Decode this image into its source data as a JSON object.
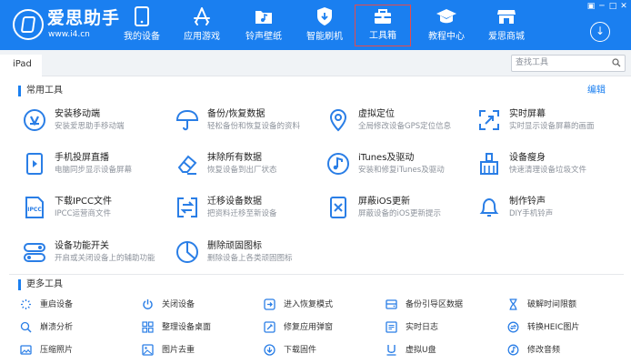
{
  "header": {
    "logo_text": "爱思助手",
    "logo_url": "www.i4.cn",
    "nav": [
      {
        "label": "我的设备",
        "icon": "phone-icon"
      },
      {
        "label": "应用游戏",
        "icon": "app-store-icon"
      },
      {
        "label": "铃声壁纸",
        "icon": "music-folder-icon"
      },
      {
        "label": "智能刷机",
        "icon": "shield-icon"
      },
      {
        "label": "工具箱",
        "icon": "toolbox-icon",
        "active": true
      },
      {
        "label": "教程中心",
        "icon": "graduation-cap-icon"
      },
      {
        "label": "爱思商城",
        "icon": "store-icon"
      }
    ],
    "window_controls": [
      "▣",
      "─",
      "□",
      "✕"
    ],
    "download_icon": "download-icon"
  },
  "tabbar": {
    "device_tab": "iPad",
    "search_placeholder": "查找工具"
  },
  "common_tools": {
    "title": "常用工具",
    "edit": "编辑",
    "items": [
      {
        "name": "安装移动端",
        "desc": "安装爱思助手移动端",
        "icon": "install-mobile-icon"
      },
      {
        "name": "备份/恢复数据",
        "desc": "轻松备份和恢复设备的资料",
        "icon": "umbrella-icon"
      },
      {
        "name": "虚拟定位",
        "desc": "全局修改设备GPS定位信息",
        "icon": "location-pin-icon"
      },
      {
        "name": "实时屏幕",
        "desc": "实时显示设备屏幕的画面",
        "icon": "screen-expand-icon"
      },
      {
        "name": "手机投屏直播",
        "desc": "电脑同步显示设备屏幕",
        "icon": "screen-cast-icon"
      },
      {
        "name": "抹除所有数据",
        "desc": "恢复设备到出厂状态",
        "icon": "eraser-icon"
      },
      {
        "name": "iTunes及驱动",
        "desc": "安装和修复iTunes及驱动",
        "icon": "itunes-icon"
      },
      {
        "name": "设备瘦身",
        "desc": "快速清理设备垃圾文件",
        "icon": "broom-icon"
      },
      {
        "name": "下载IPCC文件",
        "desc": "IPCC运营商文件",
        "icon": "ipcc-file-icon"
      },
      {
        "name": "迁移设备数据",
        "desc": "把资料迁移至新设备",
        "icon": "transfer-icon"
      },
      {
        "name": "屏蔽iOS更新",
        "desc": "屏蔽设备的iOS更新提示",
        "icon": "block-update-icon"
      },
      {
        "name": "制作铃声",
        "desc": "DIY手机铃声",
        "icon": "bell-icon"
      },
      {
        "name": "设备功能开关",
        "desc": "开启或关闭设备上的辅助功能",
        "icon": "toggle-icon"
      },
      {
        "name": "删除顽固图标",
        "desc": "删除设备上各类顽固图标",
        "icon": "pie-delete-icon"
      }
    ]
  },
  "more_tools": {
    "title": "更多工具",
    "items": [
      {
        "label": "重启设备",
        "icon": "restart-icon"
      },
      {
        "label": "关闭设备",
        "icon": "power-icon"
      },
      {
        "label": "进入恢复模式",
        "icon": "recovery-icon"
      },
      {
        "label": "备份引导区数据",
        "icon": "backup-boot-icon"
      },
      {
        "label": "破解时间限额",
        "icon": "hourglass-icon"
      },
      {
        "label": "崩溃分析",
        "icon": "crash-analysis-icon"
      },
      {
        "label": "整理设备桌面",
        "icon": "grid-icon"
      },
      {
        "label": "修复应用弹窗",
        "icon": "repair-app-icon"
      },
      {
        "label": "实时日志",
        "icon": "log-icon"
      },
      {
        "label": "转换HEIC图片",
        "icon": "heic-convert-icon"
      },
      {
        "label": "压缩照片",
        "icon": "compress-photo-icon"
      },
      {
        "label": "图片去重",
        "icon": "photo-dedupe-icon"
      },
      {
        "label": "下载固件",
        "icon": "firmware-download-icon"
      },
      {
        "label": "虚拟U盘",
        "icon": "usb-drive-icon"
      },
      {
        "label": "修改音频",
        "icon": "audio-edit-icon"
      }
    ]
  },
  "colors": {
    "brand_blue": "#1a7ff0",
    "active_border": "#e84a4a",
    "icon_blue": "#2a7ee6"
  }
}
